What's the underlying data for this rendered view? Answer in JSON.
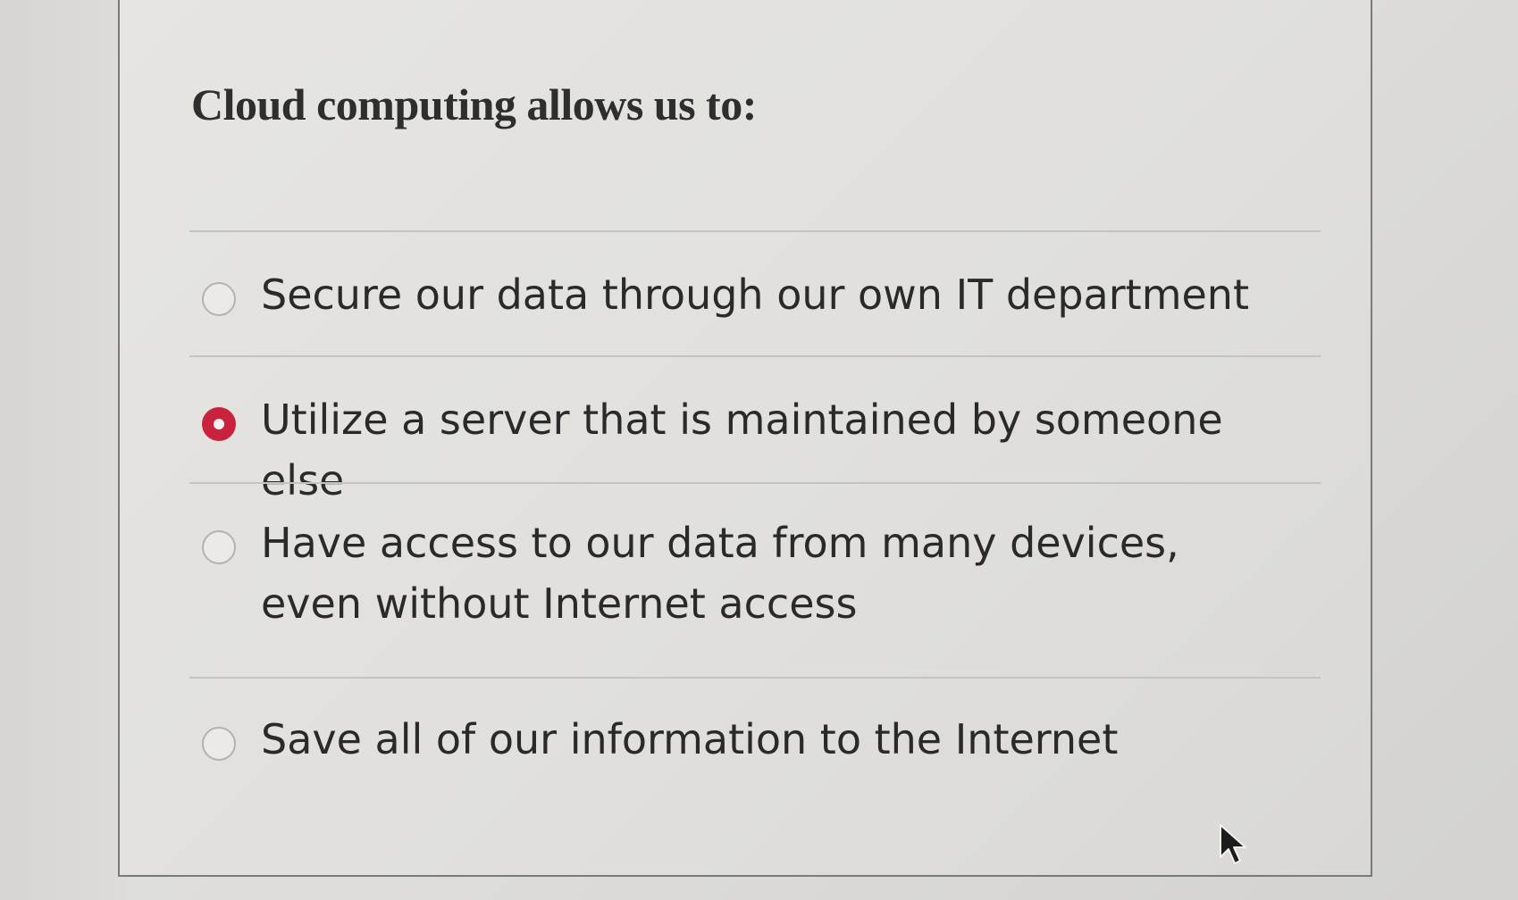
{
  "question": {
    "text": "Cloud computing allows us to:"
  },
  "answers": [
    {
      "label": "Secure our data through our own IT department",
      "selected": false
    },
    {
      "label": "Utilize a server that is maintained by someone else",
      "selected": true
    },
    {
      "label": "Have access to our data from many devices, even without Internet access",
      "selected": false
    },
    {
      "label": "Save all of our information to the Internet",
      "selected": false
    }
  ],
  "colors": {
    "selected_radio": "#c8223f",
    "text": "#2a2a2a",
    "divider": "#c4c3bf"
  },
  "icons": {
    "cursor": "mouse-pointer-icon"
  }
}
